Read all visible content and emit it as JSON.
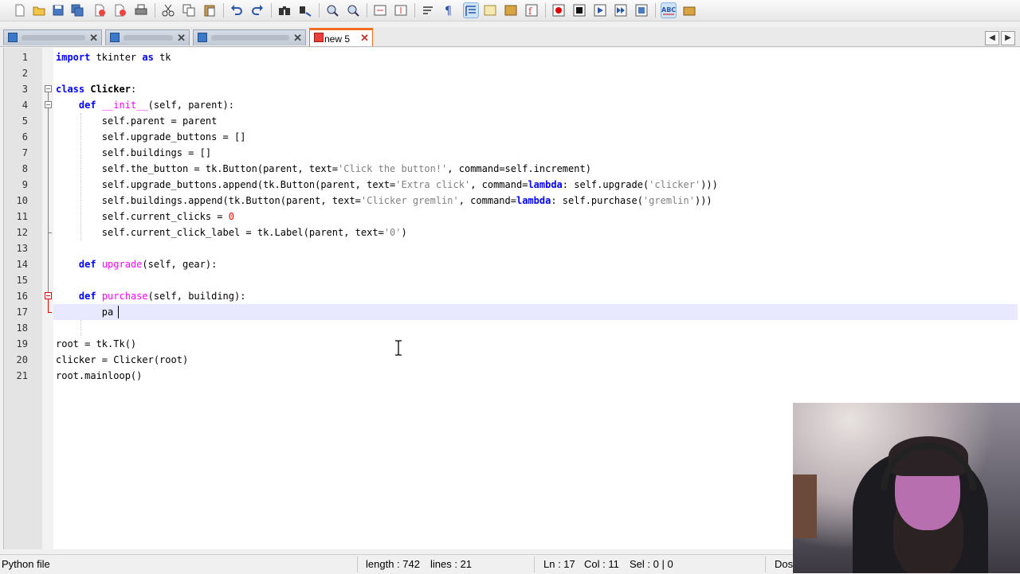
{
  "toolbar": {
    "icons": [
      "new-file-icon",
      "open-file-icon",
      "save-icon",
      "save-all-icon",
      "close-icon",
      "close-all-icon",
      "print-icon",
      "cut-icon",
      "copy-icon",
      "paste-icon",
      "undo-icon",
      "redo-icon",
      "find-icon",
      "replace-icon",
      "zoom-in-icon",
      "zoom-out-icon",
      "sync-vertical-icon",
      "sync-horizontal-icon",
      "word-wrap-icon",
      "show-all-characters-icon",
      "indent-guide-icon",
      "language-icon",
      "folder-as-workspace-icon",
      "function-list-icon",
      "record-macro-icon",
      "stop-macro-icon",
      "play-macro-icon",
      "run-macro-multiple-icon",
      "save-macro-icon",
      "spell-check-icon",
      "launch-in-browser-icon"
    ]
  },
  "tabs": [
    {
      "label": "",
      "closable": true
    },
    {
      "label": "",
      "closable": true
    },
    {
      "label": "",
      "closable": true
    },
    {
      "label": "new 5",
      "closable": true,
      "active": true
    }
  ],
  "editor": {
    "line_numbers": [
      "1",
      "2",
      "3",
      "4",
      "5",
      "6",
      "7",
      "8",
      "9",
      "10",
      "11",
      "12",
      "13",
      "14",
      "15",
      "16",
      "17",
      "18",
      "19",
      "20",
      "21"
    ],
    "current_line": 17,
    "lines": [
      "import tkinter as tk",
      "",
      "class Clicker:",
      "    def __init__(self, parent):",
      "        self.parent = parent",
      "        self.upgrade_buttons = []",
      "        self.buildings = []",
      "        self.the_button = tk.Button(parent, text='Click the button!', command=self.increment)",
      "        self.upgrade_buttons.append(tk.Button(parent, text='Extra click', command=lambda: self.upgrade('clicker')))",
      "        self.buildings.append(tk.Button(parent, text='Clicker gremlin', command=lambda: self.purchase('gremlin')))",
      "        self.current_clicks = 0",
      "        self.current_click_label = tk.Label(parent, text='0')",
      "",
      "    def upgrade(self, gear):",
      "",
      "    def purchase(self, building):",
      "        pa",
      "",
      "root = tk.Tk()",
      "clicker = Clicker(root)",
      "root.mainloop()"
    ]
  },
  "statusbar": {
    "file_type": "Python file",
    "length": "length : 742",
    "lines": "lines : 21",
    "ln": "Ln : 17",
    "col": "Col : 11",
    "sel": "Sel : 0 | 0",
    "eol": "Dos"
  }
}
